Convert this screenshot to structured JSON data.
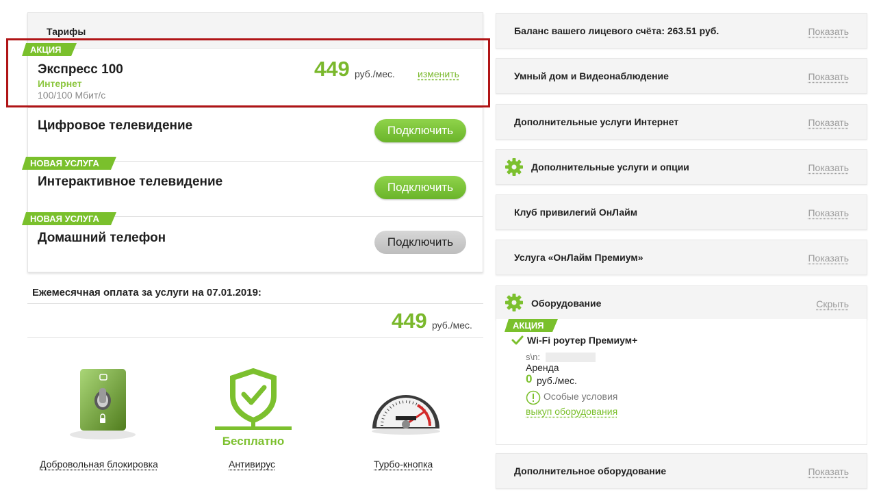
{
  "tariffs": {
    "title": "Тарифы",
    "express": {
      "ribbon": "АКЦИЯ",
      "name": "Экспресс 100",
      "type": "Интернет",
      "speed": "100/100 Мбит/с",
      "price": "449",
      "price_unit": "руб./мес.",
      "change_link": "изменить"
    },
    "digital_tv": {
      "name": "Цифровое телевидение",
      "button": "Подключить"
    },
    "interactive_tv": {
      "ribbon": "НОВАЯ УСЛУГА",
      "name": "Интерактивное телевидение",
      "button": "Подключить"
    },
    "home_phone": {
      "ribbon": "НОВАЯ УСЛУГА",
      "name": "Домашний телефон",
      "button": "Подключить"
    }
  },
  "monthly": {
    "label": "Ежемесячная оплата за услуги на 07.01.2019:",
    "price": "449",
    "unit": "руб./мес."
  },
  "features": [
    {
      "label": "Добровольная блокировка",
      "icon": "toggle-lock-icon"
    },
    {
      "label": "Антивирус",
      "icon": "shield-check-icon",
      "badge": "Бесплатно"
    },
    {
      "label": "Турбо-кнопка",
      "icon": "speedometer-icon"
    }
  ],
  "right": {
    "balance": {
      "title": "Баланс вашего лицевого счёта: 263.51 руб.",
      "link": "Показать"
    },
    "smart_home": {
      "title": "Умный дом и Видеонаблюдение",
      "link": "Показать"
    },
    "extra_internet": {
      "title": "Дополнительные услуги Интернет",
      "link": "Показать"
    },
    "extra_options": {
      "title": "Дополнительные услуги и опции",
      "link": "Показать",
      "icon": "gear-icon"
    },
    "club": {
      "title": "Клуб привилегий ОнЛайм",
      "link": "Показать"
    },
    "premium": {
      "title": "Услуга «ОнЛайм Премиум»",
      "link": "Показать"
    },
    "equipment": {
      "title": "Оборудование",
      "link": "Скрыть",
      "icon": "gear-icon",
      "ribbon": "АКЦИЯ",
      "device": "Wi-Fi роутер Премиум+",
      "sn_label": "s\\n:",
      "rent_label": "Аренда",
      "rent_price": "0",
      "rent_unit": "руб./мес.",
      "conditions": "Особые условия",
      "buyout_link": "выкуп оборудования"
    },
    "extra_equipment": {
      "title": "Дополнительное оборудование",
      "link": "Показать"
    }
  },
  "colors": {
    "accent_green": "#7ab82c",
    "ribbon_green": "#7ac02c",
    "highlight_red": "#b01416",
    "link_gray": "#9a9a9a"
  }
}
